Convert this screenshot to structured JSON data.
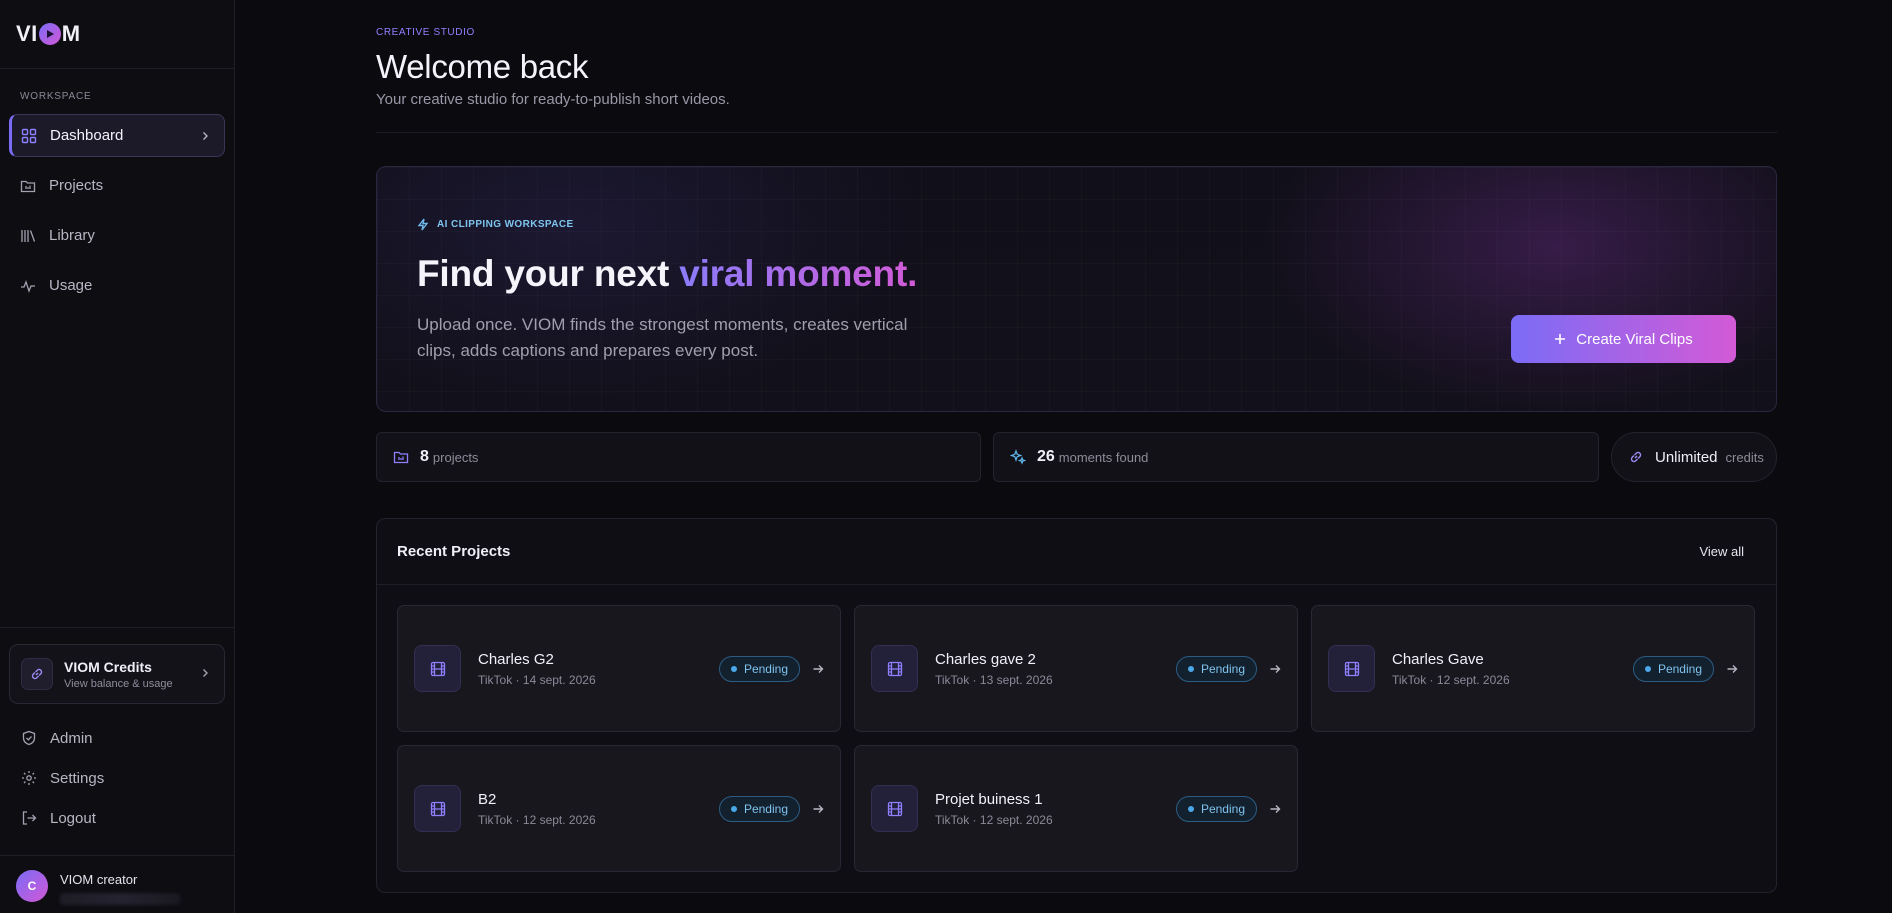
{
  "app": {
    "logo_left": "VI",
    "logo_right": "M"
  },
  "sidebar": {
    "section_label": "WORKSPACE",
    "items": [
      {
        "label": "Dashboard"
      },
      {
        "label": "Projects"
      },
      {
        "label": "Library"
      },
      {
        "label": "Usage"
      }
    ],
    "credits": {
      "title": "VIOM Credits",
      "subtitle": "View balance & usage"
    },
    "links": [
      {
        "label": "Admin"
      },
      {
        "label": "Settings"
      },
      {
        "label": "Logout"
      }
    ],
    "user": {
      "initial": "C",
      "name": "VIOM creator"
    }
  },
  "header": {
    "eyebrow": "CREATIVE STUDIO",
    "title": "Welcome back",
    "subtitle": "Your creative studio for ready-to-publish short videos."
  },
  "hero": {
    "tag": "AI CLIPPING WORKSPACE",
    "headline_plain": "Find your next ",
    "headline_accent": "viral moment.",
    "body": "Upload once. VIOM finds the strongest moments, creates vertical clips, adds captions and prepares every post.",
    "cta_label": "Create Viral Clips"
  },
  "stats": {
    "projects": {
      "value": "8",
      "label": "projects"
    },
    "moments": {
      "value": "26",
      "label": "moments found"
    },
    "credits": {
      "value": "Unlimited",
      "label": "credits"
    }
  },
  "recent": {
    "title": "Recent Projects",
    "view_all": "View all",
    "projects": [
      {
        "name": "Charles G2",
        "meta": "TikTok · 14 sept. 2026",
        "status": "Pending"
      },
      {
        "name": "Charles gave 2",
        "meta": "TikTok · 13 sept. 2026",
        "status": "Pending"
      },
      {
        "name": "Charles Gave",
        "meta": "TikTok · 12 sept. 2026",
        "status": "Pending"
      },
      {
        "name": "B2",
        "meta": "TikTok · 12 sept. 2026",
        "status": "Pending"
      },
      {
        "name": "Projet buiness 1",
        "meta": "TikTok · 12 sept. 2026",
        "status": "Pending"
      }
    ]
  },
  "colors": {
    "accent": "#7b6cf6",
    "accent_2": "#d35ad6",
    "status_pending": "#7fc3ef"
  }
}
